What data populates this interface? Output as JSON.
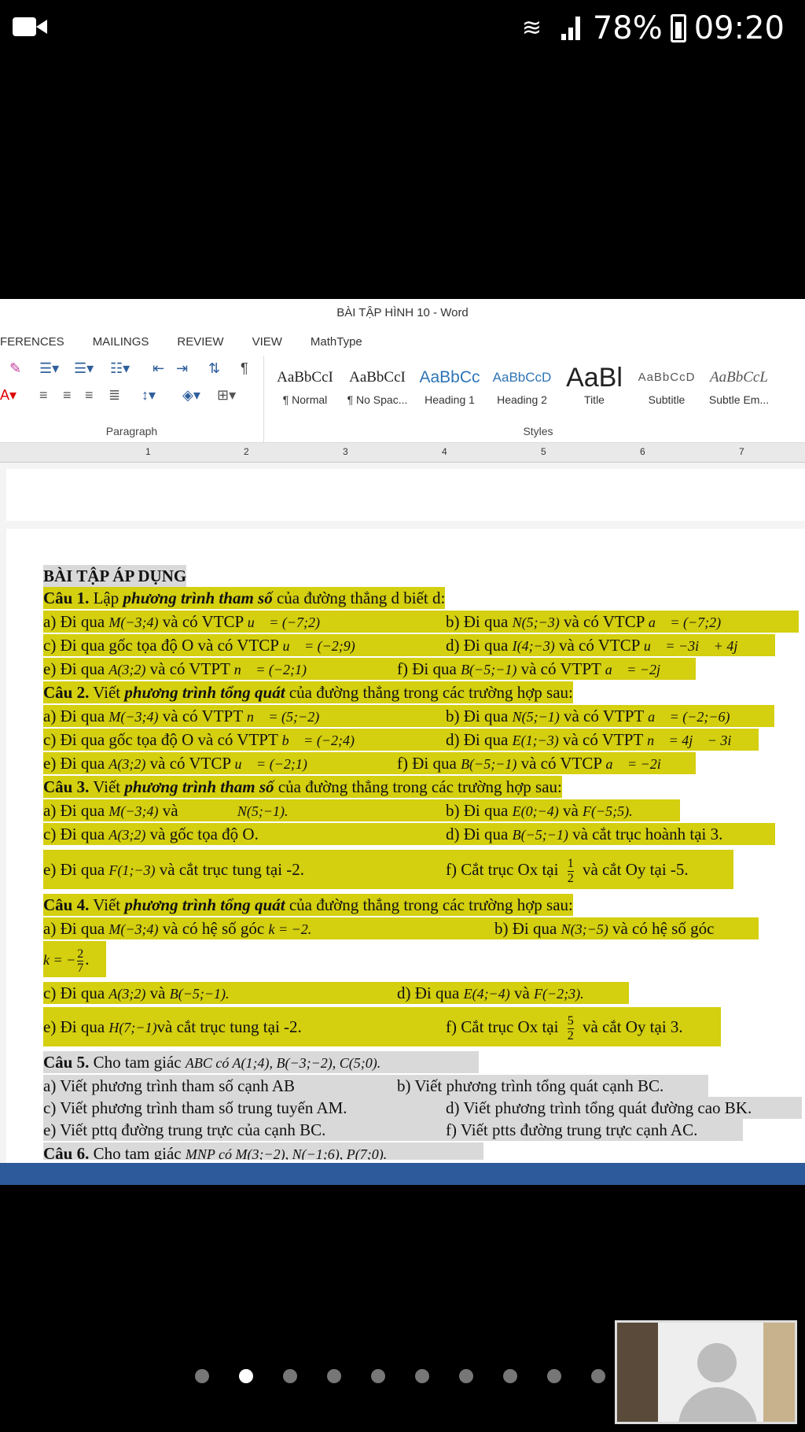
{
  "status": {
    "battery": "78%",
    "time": "09:20"
  },
  "word": {
    "title": "BÀI TẬP HÌNH 10 - Word",
    "tabs": [
      "FERENCES",
      "MAILINGS",
      "REVIEW",
      "VIEW",
      "MathType"
    ],
    "paragraph_label": "Paragraph",
    "styles_label": "Styles",
    "styles": [
      {
        "sample": "AaBbCcI",
        "name": "¶ Normal",
        "color": "#222222"
      },
      {
        "sample": "AaBbCcI",
        "name": "¶ No Spac...",
        "color": "#222222"
      },
      {
        "sample": "AaBbCc",
        "name": "Heading 1",
        "color": "#2e74b5"
      },
      {
        "sample": "AaBbCcD",
        "name": "Heading 2",
        "color": "#2e74b5"
      },
      {
        "sample": "AaBl",
        "name": "Title",
        "color": "#222222"
      },
      {
        "sample": "AaBbCcD",
        "name": "Subtitle",
        "color": "#555555"
      },
      {
        "sample": "AaBbCcL",
        "name": "Subtle Em...",
        "color": "#555555"
      }
    ],
    "ruler_numbers": [
      "1",
      "2",
      "3",
      "4",
      "5",
      "6",
      "7"
    ]
  },
  "doc": {
    "heading": "BÀI TẬP ÁP DỤNG",
    "c1": {
      "label": "Câu 1.",
      "pre": " Lập ",
      "em": "phương trình tham số",
      "post": " của đường thẳng d  biết d:"
    },
    "c1a": {
      "left": "a) Đi qua ",
      "m1": "M(−3;4)",
      "mid": " và có VTCP ",
      "m2": "u⃗ = (−7;2)"
    },
    "c1b": {
      "text": "b) Đi qua ",
      "m1": "N(5;−3)",
      "mid": " và có VTCP ",
      "m2": "a⃗ = (−7;2)"
    },
    "c1c": {
      "text": "c) Đi qua gốc tọa độ O và có VTCP ",
      "m": "u⃗ = (−2;9)"
    },
    "c1d": {
      "text": "d) Đi qua ",
      "m1": "I(4;−3)",
      "mid": " và có VTCP ",
      "m2": "u⃗ = −3i⃗ + 4j⃗"
    },
    "c1e": {
      "text": "e) Đi qua ",
      "m1": "A(3;2)",
      "mid": " và có VTPT ",
      "m2": "n⃗ = (−2;1)"
    },
    "c1f": {
      "text": "f) Đi qua ",
      "m1": "B(−5;−1)",
      "mid": " và có VTPT ",
      "m2": "a⃗ = −2j⃗"
    },
    "c2": {
      "label": "Câu 2.",
      "pre": " Viết ",
      "em": "phương trình tổng quát",
      "post": " của đường thẳng trong các trường hợp sau:"
    },
    "c2a": {
      "text": "a) Đi qua ",
      "m1": "M(−3;4)",
      "mid": " và có VTPT ",
      "m2": "n⃗ = (5;−2)"
    },
    "c2b": {
      "text": "b) Đi qua ",
      "m1": "N(5;−1)",
      "mid": " và có VTPT ",
      "m2": "a⃗ = (−2;−6)"
    },
    "c2c": {
      "text": "c) Đi qua gốc tọa độ O và có VTPT ",
      "m": "b⃗ = (−2;4)"
    },
    "c2d": {
      "text": "d) Đi qua ",
      "m1": "E(1;−3)",
      "mid": " và có VTPT ",
      "m2": "n⃗ = 4j⃗ − 3i⃗"
    },
    "c2e": {
      "text": "e) Đi qua ",
      "m1": "A(3;2)",
      "mid": " và có VTCP ",
      "m2": "u⃗ = (−2;1)"
    },
    "c2f": {
      "text": "f) Đi qua ",
      "m1": "B(−5;−1)",
      "mid": " và có VTCP ",
      "m2": "a⃗ = −2i⃗"
    },
    "c3": {
      "label": "Câu 3.",
      "pre": " Viết ",
      "em": "phương trình tham số",
      "post": " của đường thẳng trong các trường hợp sau:"
    },
    "c3a": {
      "text": "a) Đi qua ",
      "m1": "M(−3;4)",
      "mid": " và ",
      "m2": "N(5;−1)."
    },
    "c3b": {
      "text": "b) Đi qua ",
      "m1": "E(0;−4)",
      "mid": " và ",
      "m2": "F(−5;5)."
    },
    "c3c": {
      "text": "c) Đi qua ",
      "m1": "A(3;2)",
      "post": " và gốc tọa độ O."
    },
    "c3d": {
      "text": "d) Đi qua ",
      "m1": "B(−5;−1)",
      "post": " và cắt trục hoành tại 3."
    },
    "c3e": {
      "text": "e) Đi qua ",
      "m1": "F(1;−3)",
      "post": " và cắt trục tung tại -2."
    },
    "c3f": {
      "text": "f) Cắt trục Ox tại ",
      "num": "1",
      "den": "2",
      "post": " và cắt Oy tại -5."
    },
    "c4": {
      "label": "Câu 4.",
      "pre": " Viết ",
      "em": "phương trình tổng quát",
      "post": " của đường thẳng trong các trường hợp sau:"
    },
    "c4a": {
      "text": "a) Đi qua ",
      "m1": "M(−3;4)",
      "mid": " và        có hệ số góc ",
      "m2": "k = −2."
    },
    "c4b": {
      "text": "b) Đi qua ",
      "m1": "N(3;−5)",
      "post": " và có hệ số góc"
    },
    "c4b2": {
      "pre": "k = −",
      "num": "2",
      "den": "7",
      "post": "."
    },
    "c4c": {
      "text": "c) Đi qua ",
      "m1": "A(3;2)",
      "mid": " và ",
      "m2": "B(−5;−1)."
    },
    "c4d": {
      "text": "d) Đi qua ",
      "m1": "E(4;−4)",
      "mid": " và ",
      "m2": "F(−2;3)."
    },
    "c4e": {
      "text": "e) Đi qua  ",
      "m1": "H(7;−1)",
      "post": "và cắt trục tung tại -2."
    },
    "c4f": {
      "text": "f) Cắt trục Ox tại ",
      "num": "5",
      "den": "2",
      "post": " và cắt Oy tại 3."
    },
    "c5": {
      "label": "Câu 5.",
      "pre": "  Cho tam giác ",
      "m": "ABC có A(1;4), B(−3;−2), C(5;0)."
    },
    "c5a": "a) Viết phương trình tham số cạnh AB",
    "c5b": "b) Viết phương trình tổng quát cạnh BC.",
    "c5c": "c) Viết phương trình tham số trung tuyến AM.",
    "c5d": "d) Viết phương trình tổng quát đường cao BK.",
    "c5e": "e) Viết pttq đường trung trực của cạnh BC.",
    "c5f": "f) Viết ptts đường trung trực cạnh AC.",
    "c6": {
      "label": "Câu 6.",
      "pre": "  Cho tam giác ",
      "m": "MNP có M(3;−2), N(−1;6), P(7;0)."
    }
  }
}
